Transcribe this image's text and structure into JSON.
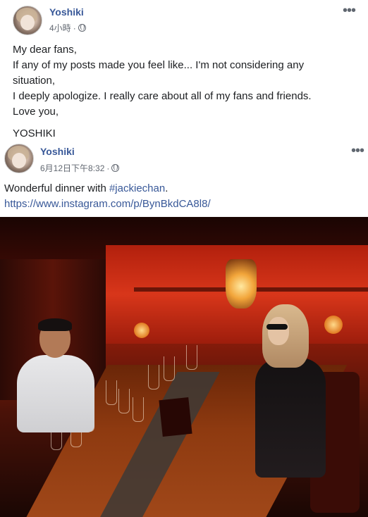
{
  "posts": [
    {
      "author": "Yoshiki",
      "timestamp": "4小時",
      "privacy_icon": "globe-icon",
      "more_icon": "more-options-icon",
      "more_glyph": "•••",
      "lines": [
        "My dear fans,",
        "If any of my posts made you feel like... I'm not considering any situation,",
        "I deeply apologize. I really care about all of my fans and friends.",
        "Love you,"
      ],
      "signature": "YOSHIKI"
    },
    {
      "author": "Yoshiki",
      "timestamp": "6月12日下午8:32",
      "privacy_icon": "globe-icon",
      "more_icon": "more-options-icon",
      "more_glyph": "•••",
      "text_prefix": "Wonderful dinner with ",
      "hashtag": "#jackiechan",
      "text_suffix": ".",
      "url": "https://www.instagram.com/p/BynBkdCA8l8/"
    }
  ],
  "colors": {
    "link": "#385898",
    "meta": "#616770",
    "text": "#1c1e21"
  }
}
